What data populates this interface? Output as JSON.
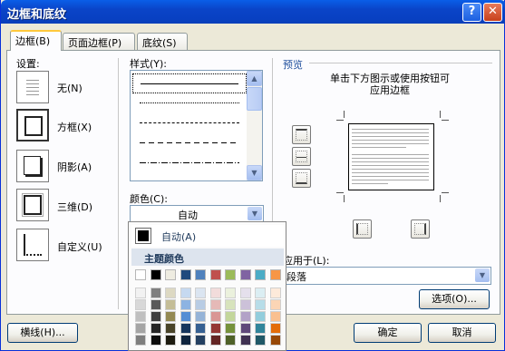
{
  "window": {
    "title": "边框和底纹",
    "help_label": "?",
    "close_label": "✕"
  },
  "tabs": [
    {
      "label": "边框(B)",
      "active": true
    },
    {
      "label": "页面边框(P)",
      "active": false
    },
    {
      "label": "底纹(S)",
      "active": false
    }
  ],
  "settings": {
    "label": "设置:",
    "items": [
      {
        "label": "无(N)",
        "icon": "border-none-icon",
        "selected": false
      },
      {
        "label": "方框(X)",
        "icon": "border-box-icon",
        "selected": true
      },
      {
        "label": "阴影(A)",
        "icon": "border-shadow-icon",
        "selected": false
      },
      {
        "label": "三维(D)",
        "icon": "border-3d-icon",
        "selected": false
      },
      {
        "label": "自定义(U)",
        "icon": "border-custom-icon",
        "selected": false
      }
    ]
  },
  "style": {
    "label": "样式(Y):",
    "items": [
      "solid",
      "dotted",
      "dashed-fine",
      "dashed",
      "dash-dot",
      "dash-dot-dot"
    ]
  },
  "color": {
    "label": "颜色(C):",
    "value": "自动",
    "popup": {
      "auto_label": "自动(A)",
      "theme_header": "主题颜色",
      "top_row": [
        "#ffffff",
        "#000000",
        "#eeece1",
        "#1f497d",
        "#4f81bd",
        "#c0504d",
        "#9bbb59",
        "#8064a2",
        "#4bacc6",
        "#f79646"
      ],
      "shades": [
        [
          "#f2f2f2",
          "#d8d8d8",
          "#bfbfbf",
          "#a5a5a5",
          "#7f7f7f"
        ],
        [
          "#7f7f7f",
          "#595959",
          "#3f3f3f",
          "#262626",
          "#0c0c0c"
        ],
        [
          "#ddd9c3",
          "#c4bd97",
          "#938953",
          "#494429",
          "#1d1b10"
        ],
        [
          "#c6d9f0",
          "#8db3e2",
          "#548dd4",
          "#17365d",
          "#0f243e"
        ],
        [
          "#dbe5f1",
          "#b8cce4",
          "#95b3d7",
          "#366092",
          "#244061"
        ],
        [
          "#f2dcdb",
          "#e5b9b7",
          "#d99694",
          "#953734",
          "#632423"
        ],
        [
          "#ebf1dd",
          "#d7e3bc",
          "#c3d69b",
          "#76923c",
          "#4f6128"
        ],
        [
          "#e5e0ec",
          "#ccc1d9",
          "#b2a2c7",
          "#5f497a",
          "#3f3151"
        ],
        [
          "#dbeef3",
          "#b7dde8",
          "#92cddc",
          "#31859b",
          "#205867"
        ],
        [
          "#fdeada",
          "#fbd5b5",
          "#fac08f",
          "#e36c09",
          "#974806"
        ]
      ]
    }
  },
  "preview": {
    "label": "预览",
    "hint_line1": "单击下方图示或使用按钮可",
    "hint_line2": "应用边框"
  },
  "apply_to": {
    "label": "应用于(L):",
    "value": "段落"
  },
  "buttons": {
    "options": "选项(O)...",
    "horizontal_line": "横线(H)...",
    "ok": "确定",
    "cancel": "取消"
  }
}
